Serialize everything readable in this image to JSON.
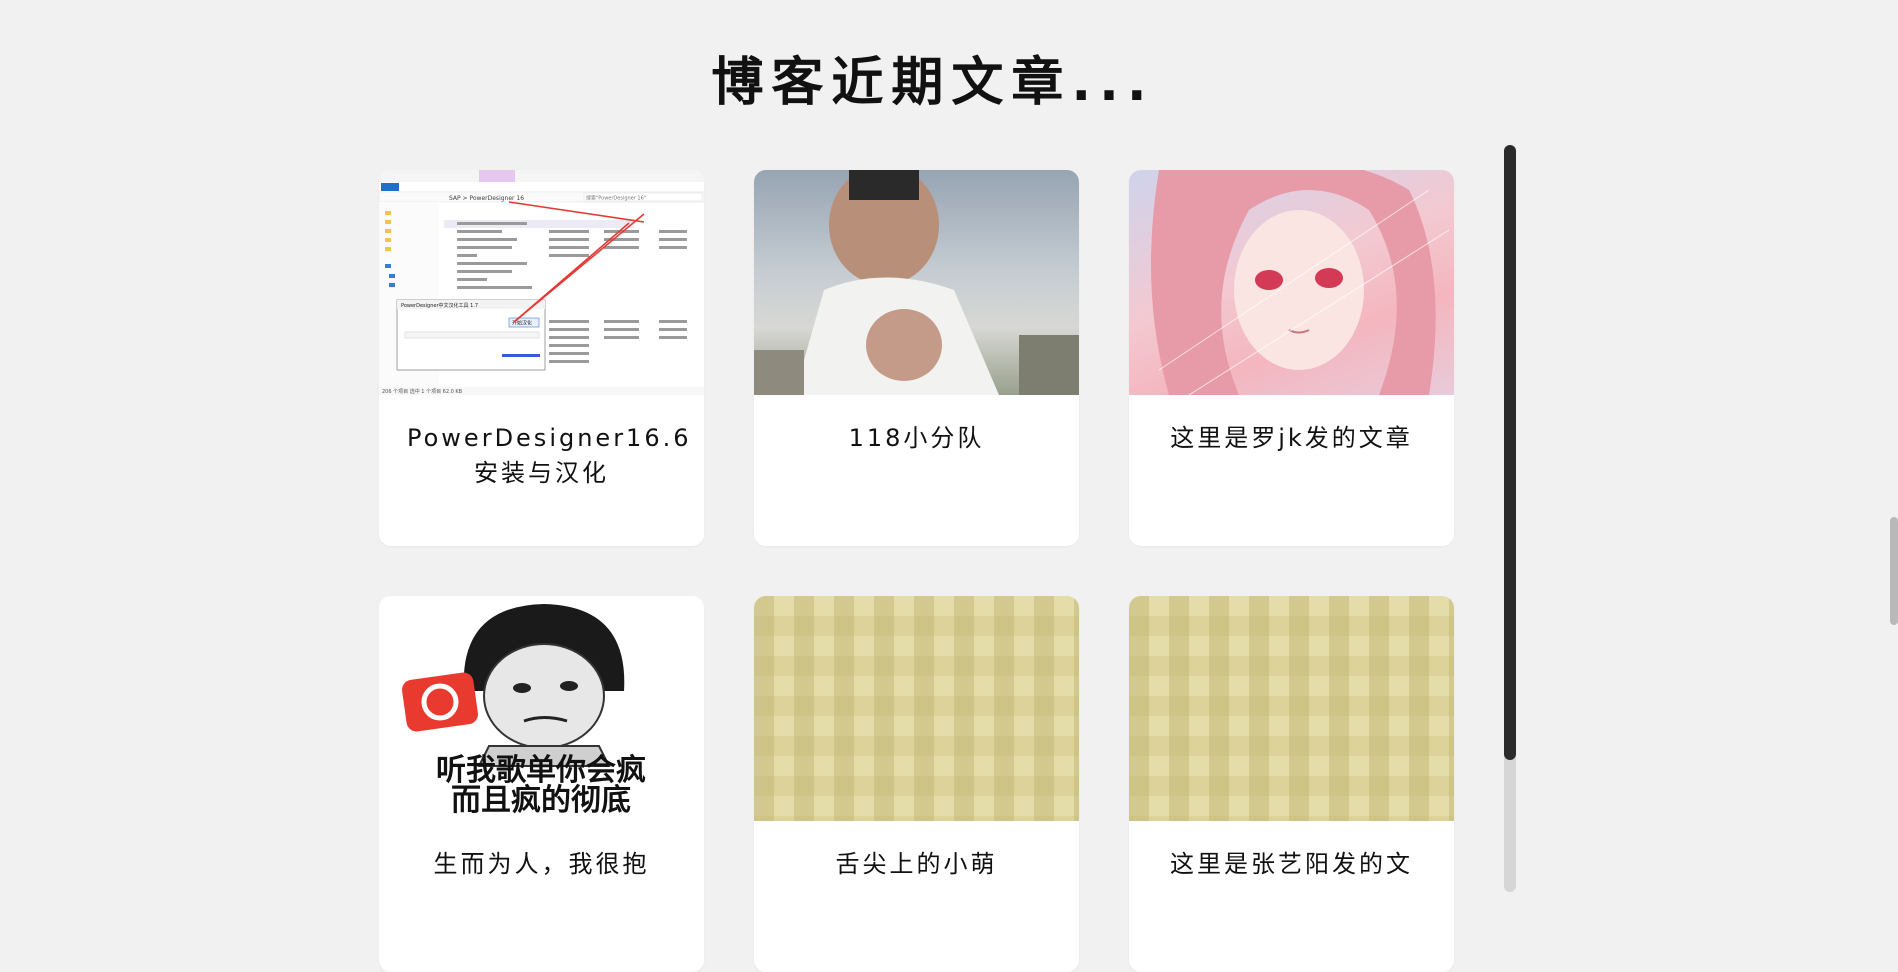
{
  "page": {
    "title": "博客近期文章..."
  },
  "articles": [
    {
      "title": "PowerDesigner16.6安装与汉化",
      "image": "installer-screenshot"
    },
    {
      "title": "118小分队",
      "image": "man-photo"
    },
    {
      "title": "这里是罗jk发的文章",
      "image": "anime-girl-illustration"
    },
    {
      "title": "生而为人，我很抱",
      "image": "meme-image"
    },
    {
      "title": "舌尖上的小萌",
      "image": "pixel-texture"
    },
    {
      "title": "这里是张艺阳发的文",
      "image": "pixel-texture"
    }
  ],
  "screenshot_window": {
    "path": "SAP > PowerDesigner 16",
    "search_placeholder": "搜索\"PowerDesigner 16\"",
    "dialog_title": "PowerDesigner中文汉化工具 1.7",
    "dialog_button": "开始汉化",
    "status": "206 个项目  选中 1 个项目 62.0 KB",
    "files": [
      "汉化PowerDesignerTools",
      "1065.CFG",
      "Annot16.bin",
      "AnalyzeDesk.dll",
      "bpm",
      "bpmx10.mdd.configuration",
      "bpmx16.config",
      "bridge",
      "com.sap.db.sapdbc.dll"
    ]
  },
  "meme": {
    "caption_line1": "听我歌单你会疯",
    "caption_line2": "而且疯的彻底"
  },
  "colors": {
    "background": "#f1f1f1",
    "card": "#ffffff",
    "scroll_thumb": "#2b2b2b",
    "netease_red": "#e83a2f",
    "arrow_red": "#e53935"
  }
}
